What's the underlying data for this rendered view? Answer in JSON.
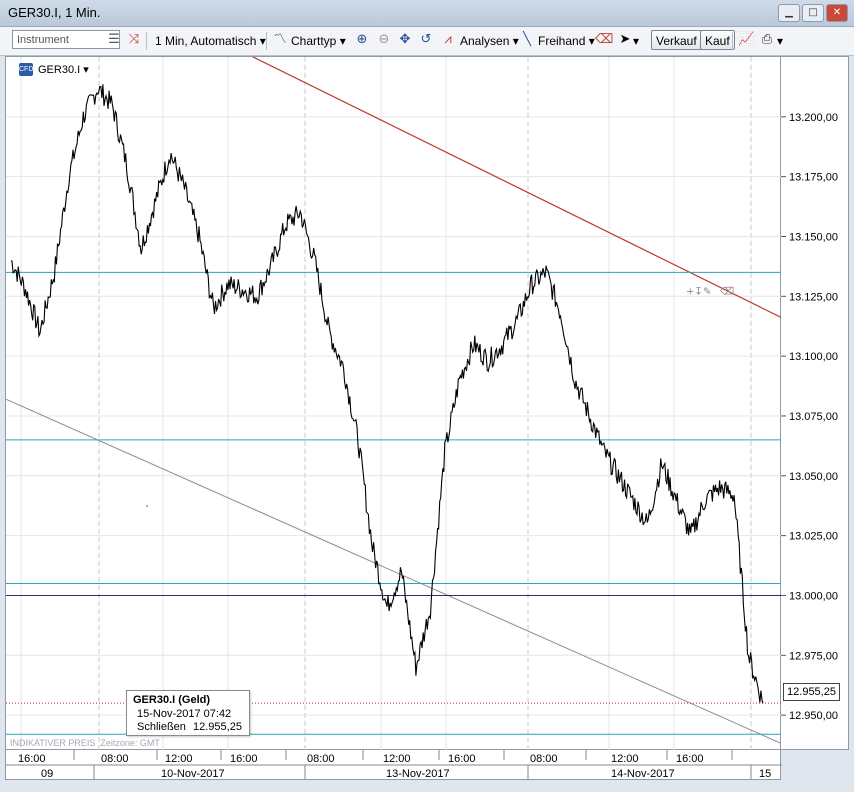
{
  "window": {
    "title": "GER30.I, 1 Min."
  },
  "toolbar": {
    "instrument_placeholder": "Instrument",
    "timeframe_label": "1 Min, Automatisch",
    "charttype_label": "Charttyp",
    "analysen_label": "Analysen",
    "freihand_label": "Freihand",
    "sell_label": "Verkauf",
    "buy_label": "Kauf"
  },
  "chart": {
    "symbol": "GER30.I",
    "badge": "CFD",
    "footer_price_type": "INDIKATIVER PREIS",
    "footer_timezone": "Zeitzone: GMT",
    "current_price": "12.955,25",
    "y_ticks": [
      "13.200,00",
      "13.175,00",
      "13.150,00",
      "13.125,00",
      "13.100,00",
      "13.075,00",
      "13.050,00",
      "13.025,00",
      "13.000,00",
      "12.975,00",
      "12.950,00"
    ],
    "time_ticks": [
      "16:00",
      "08:00",
      "12:00",
      "16:00",
      "08:00",
      "12:00",
      "16:00",
      "08:00",
      "12:00",
      "16:00"
    ],
    "date_ticks": [
      "09",
      "10-Nov-2017",
      "13-Nov-2017",
      "14-Nov-2017",
      "15"
    ],
    "infobox": {
      "title": "GER30.I (Geld)",
      "datetime": "15-Nov-2017 07:42",
      "close_label": "Schließen",
      "close_value": "12.955,25"
    },
    "colors": {
      "price_line": "#000000",
      "trend_red": "#c0392b",
      "trend_gray": "#8c8c8c",
      "hline_teal": "#2aa6b5",
      "hline_navy": "#2b2f6b"
    }
  },
  "chart_data": {
    "type": "line",
    "series": [
      {
        "values": [
          13140,
          13128,
          13110,
          13135,
          13175,
          13200,
          13212,
          13205,
          13180,
          13145,
          13165,
          13185,
          13170,
          13150,
          13120,
          13130,
          13128,
          13125,
          13138,
          13155,
          13160,
          13140,
          13110,
          13095,
          13065,
          13020,
          12995,
          13010,
          12970,
          12995,
          13060,
          13090,
          13105,
          13098,
          13105,
          13115,
          13130,
          13135,
          13118,
          13090,
          13075,
          13060,
          13050,
          13040,
          13030,
          13055,
          13040,
          13025,
          13040,
          13045,
          13042,
          12975,
          12955
        ]
      }
    ],
    "ylim": [
      12935,
      13225
    ],
    "y_ticks": [
      13200,
      13175,
      13150,
      13125,
      13100,
      13075,
      13050,
      13025,
      13000,
      12975,
      12950
    ],
    "horizontal_lines": [
      13135,
      13065,
      13005,
      13000,
      12955,
      12942
    ],
    "grid": true,
    "last_value": 12955.25
  }
}
